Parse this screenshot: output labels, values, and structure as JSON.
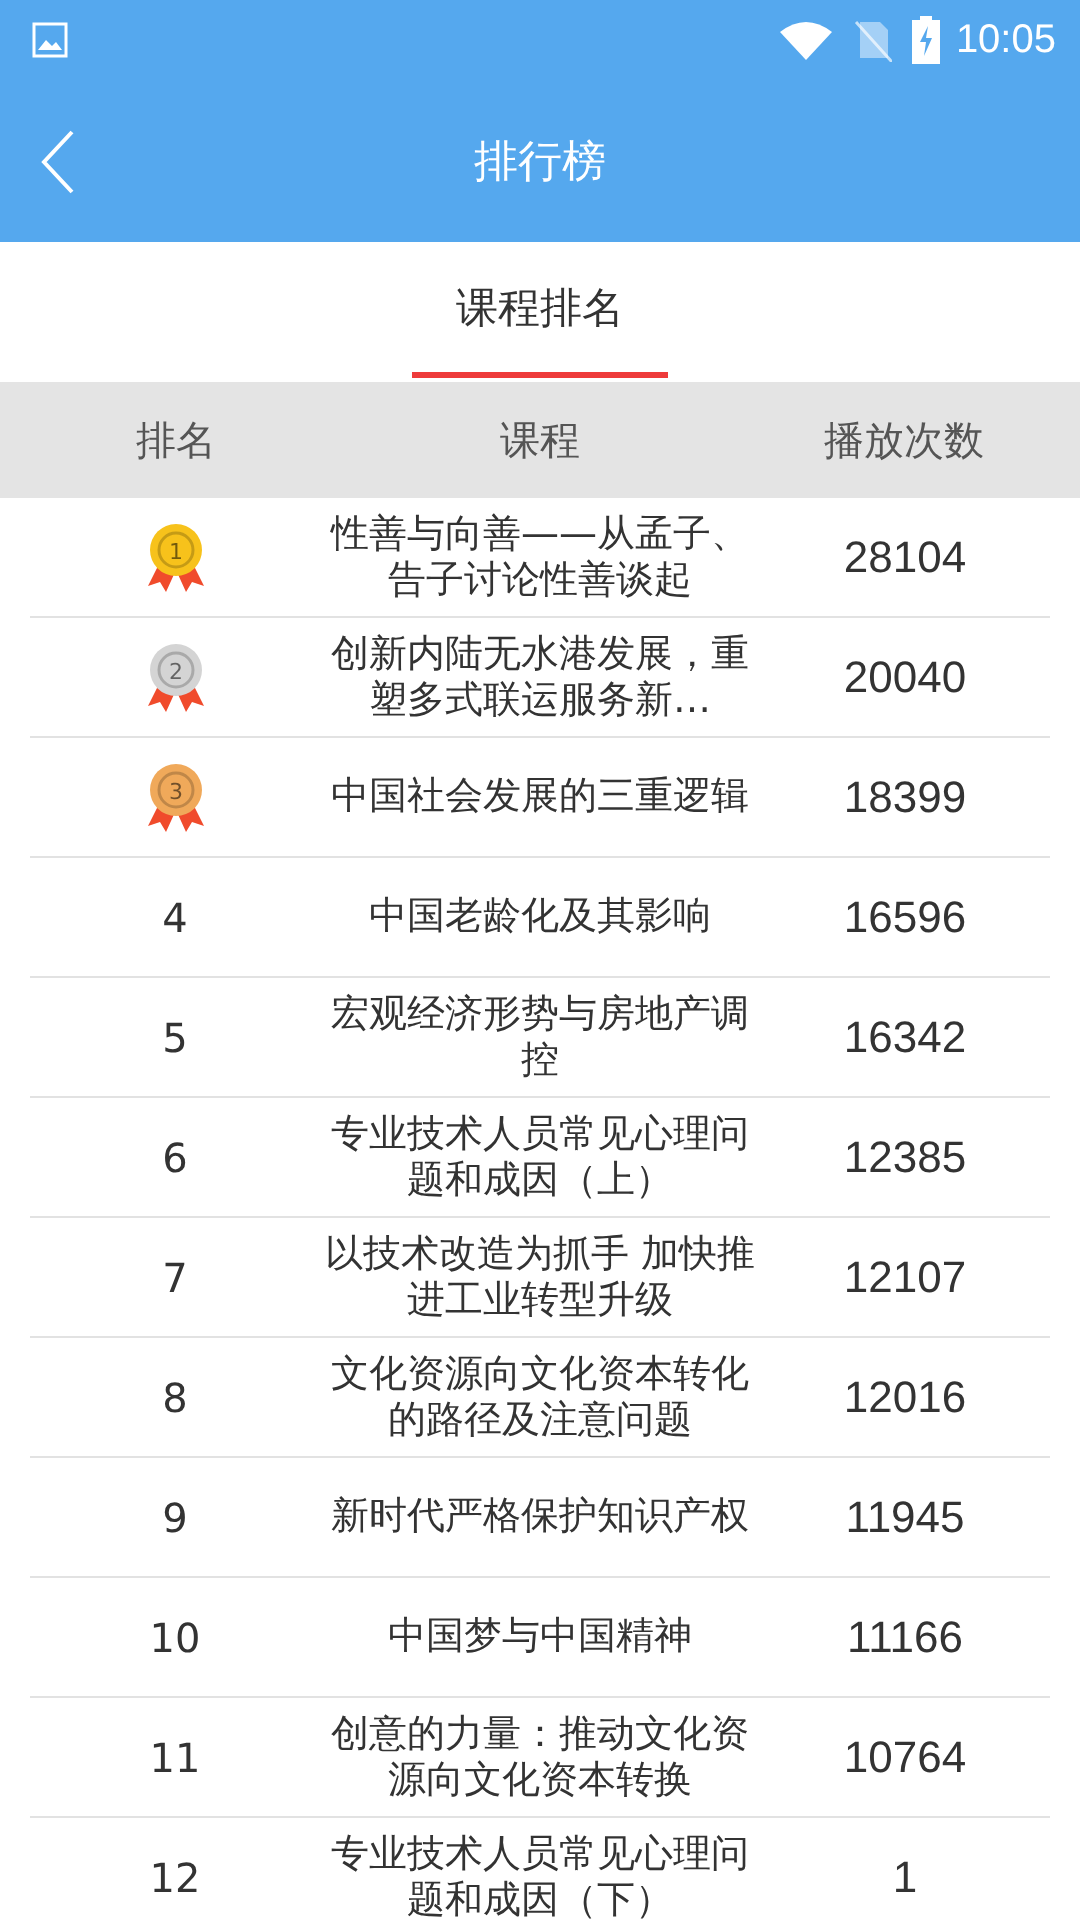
{
  "status_bar": {
    "time": "10:05"
  },
  "header": {
    "title": "排行榜"
  },
  "tabs": [
    {
      "label": "课程排名",
      "selected": true
    }
  ],
  "table": {
    "columns": [
      "排名",
      "课程",
      "播放次数"
    ],
    "rows": [
      {
        "rank": "1",
        "kind": "medal",
        "color": "#f7c21b",
        "course": "性善与向善——从孟子、告子讨论性善谈起",
        "plays": "28104"
      },
      {
        "rank": "2",
        "kind": "medal",
        "color": "#d4d4d4",
        "course": "创新内陆无水港发展，重塑多式联运服务新…",
        "plays": "20040"
      },
      {
        "rank": "3",
        "kind": "medal",
        "color": "#f0a95a",
        "course": "中国社会发展的三重逻辑",
        "plays": "18399"
      },
      {
        "rank": "4",
        "kind": "number",
        "course": "中国老龄化及其影响",
        "plays": "16596"
      },
      {
        "rank": "5",
        "kind": "number",
        "course": "宏观经济形势与房地产调控",
        "plays": "16342"
      },
      {
        "rank": "6",
        "kind": "number",
        "course": "专业技术人员常见心理问题和成因（上）",
        "plays": "12385"
      },
      {
        "rank": "7",
        "kind": "number",
        "course": "以技术改造为抓手 加快推进工业转型升级",
        "plays": "12107"
      },
      {
        "rank": "8",
        "kind": "number",
        "course": "文化资源向文化资本转化的路径及注意问题",
        "plays": "12016"
      },
      {
        "rank": "9",
        "kind": "number",
        "course": "新时代严格保护知识产权",
        "plays": "11945"
      },
      {
        "rank": "10",
        "kind": "number",
        "course": "中国梦与中国精神",
        "plays": "11166"
      },
      {
        "rank": "11",
        "kind": "number",
        "course": "创意的力量：推动文化资源向文化资本转换",
        "plays": "10764"
      },
      {
        "rank": "12",
        "kind": "number",
        "course": "专业技术人员常见心理问题和成因（下）",
        "plays": "1"
      }
    ]
  }
}
